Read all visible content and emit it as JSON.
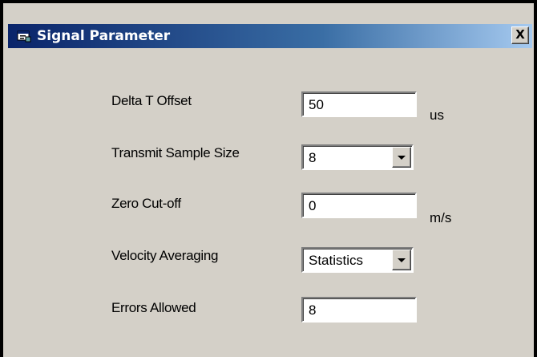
{
  "window": {
    "title": "Signal Parameter",
    "close_label": "X"
  },
  "fields": {
    "delta_t_offset": {
      "label": "Delta T Offset",
      "value": "50",
      "unit": "us"
    },
    "transmit_sample_size": {
      "label": "Transmit Sample Size",
      "value": "8"
    },
    "zero_cutoff": {
      "label": "Zero Cut-off",
      "value": "0",
      "unit": "m/s"
    },
    "velocity_averaging": {
      "label": "Velocity Averaging",
      "value": "Statistics"
    },
    "errors_allowed": {
      "label": "Errors Allowed",
      "value": "8"
    }
  },
  "icons": {
    "title_icon": "app-window-icon",
    "dropdown_icon": "chevron-down-icon"
  },
  "colors": {
    "titlebar_start": "#0a246a",
    "titlebar_end": "#a6caf0",
    "dialog_face": "#d4d0c8"
  }
}
